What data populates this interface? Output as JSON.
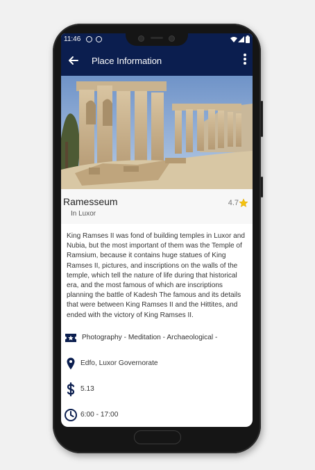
{
  "status_bar": {
    "time": "11:46"
  },
  "app_bar": {
    "title": "Place Information"
  },
  "place": {
    "name": "Ramesseum",
    "location_line": "In Luxor",
    "rating": "4.7",
    "description": "King Ramses II was fond of building temples in Luxor and Nubia, but the most important of them was the Temple of Ramsium, because it contains huge statues of King Ramses II, pictures, and inscriptions on the walls of the temple, which tell the nature of life during that historical era, and the most famous of which are inscriptions planning the battle of Kadesh The famous and its details that were between King Ramses II and the Hittites, and ended with the victory of King Ramses II."
  },
  "details": {
    "activities": "Photography - Meditation - Archaeological -",
    "address": "Edfo, Luxor Governorate",
    "price": "5.13",
    "hours": "6:00  -  17:00"
  },
  "icons": {
    "back": "arrow-left-icon",
    "more": "more-vert-icon",
    "star": "star-icon",
    "activities": "ticket-star-icon",
    "address": "map-pin-icon",
    "price": "dollar-icon",
    "hours": "clock-icon"
  },
  "colors": {
    "app_bar": "#0b1e4f",
    "icon": "#0b1e4f",
    "star": "#f4c20d",
    "header_row": "#f7f7f7"
  }
}
